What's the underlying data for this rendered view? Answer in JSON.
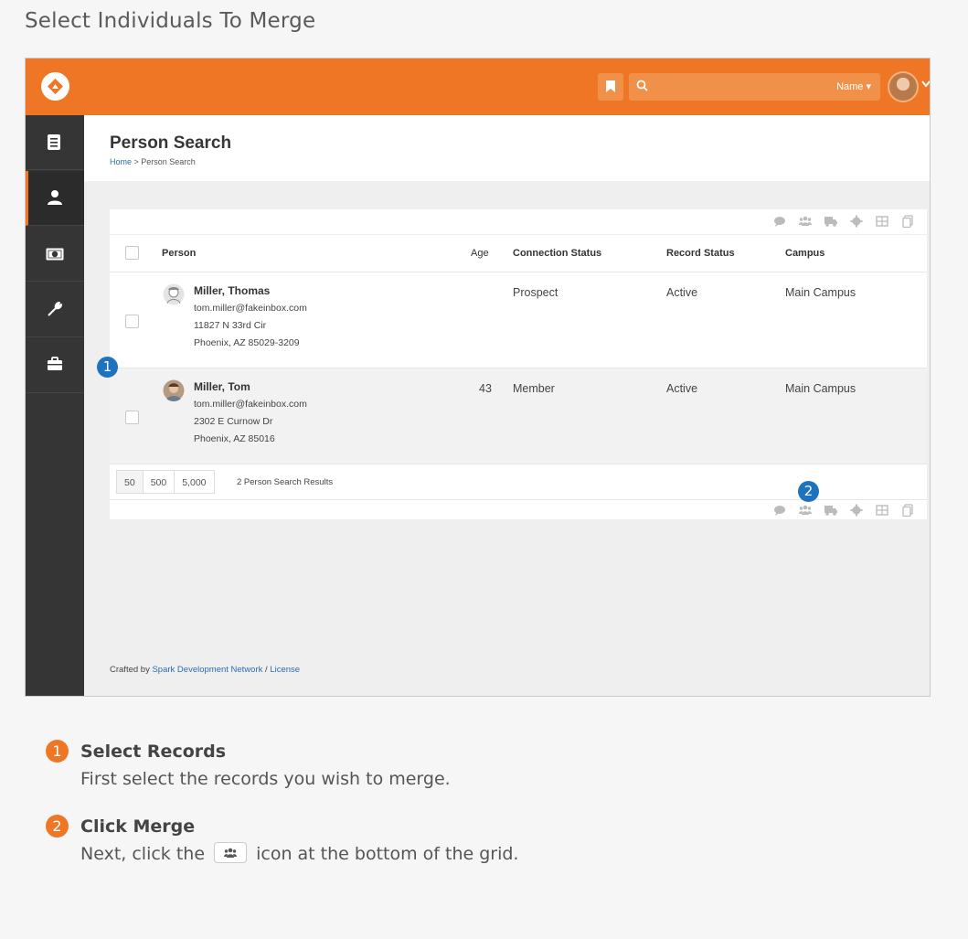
{
  "doc": {
    "title": "Select Individuals To Merge"
  },
  "topbar": {
    "search_placeholder": "",
    "search_filter": "Name ▾"
  },
  "page": {
    "title": "Person Search",
    "breadcrumb_home": "Home",
    "breadcrumb_sep": " > ",
    "breadcrumb_current": "Person Search"
  },
  "grid": {
    "columns": [
      "Person",
      "Age",
      "Connection Status",
      "Record Status",
      "Campus"
    ],
    "rows": [
      {
        "name": "Miller, Thomas",
        "email": "tom.miller@fakeinbox.com",
        "address1": "11827 N 33rd Cir",
        "address2": "Phoenix, AZ 85029-3209",
        "age": "",
        "connection_status": "Prospect",
        "record_status": "Active",
        "campus": "Main Campus"
      },
      {
        "name": "Miller, Tom",
        "email": "tom.miller@fakeinbox.com",
        "address1": "2302 E Curnow Dr",
        "address2": "Phoenix, AZ 85016",
        "age": "43",
        "connection_status": "Member",
        "record_status": "Active",
        "campus": "Main Campus"
      }
    ],
    "page_sizes": [
      "50",
      "500",
      "5,000"
    ],
    "result_count": "2 Person Search Results",
    "toolbar_icons": [
      "communicate-icon",
      "merge-icon",
      "bulk-update-icon",
      "settings-icon",
      "excel-export-icon",
      "merge-template-icon"
    ]
  },
  "footer": {
    "prefix": "Crafted by ",
    "org": "Spark Development Network",
    "sep": " / ",
    "license": "License"
  },
  "markers": [
    "1",
    "2"
  ],
  "notes": [
    {
      "num": "1",
      "title": "Select Records",
      "desc": "First select the records you wish to merge."
    },
    {
      "num": "2",
      "title": "Click Merge",
      "desc_before": "Next, click the",
      "desc_after": "icon at the bottom of the grid."
    }
  ],
  "colors": {
    "accent": "#ee7624",
    "sidebar": "#353535",
    "marker": "#1e73be",
    "link": "#2c6db0"
  }
}
